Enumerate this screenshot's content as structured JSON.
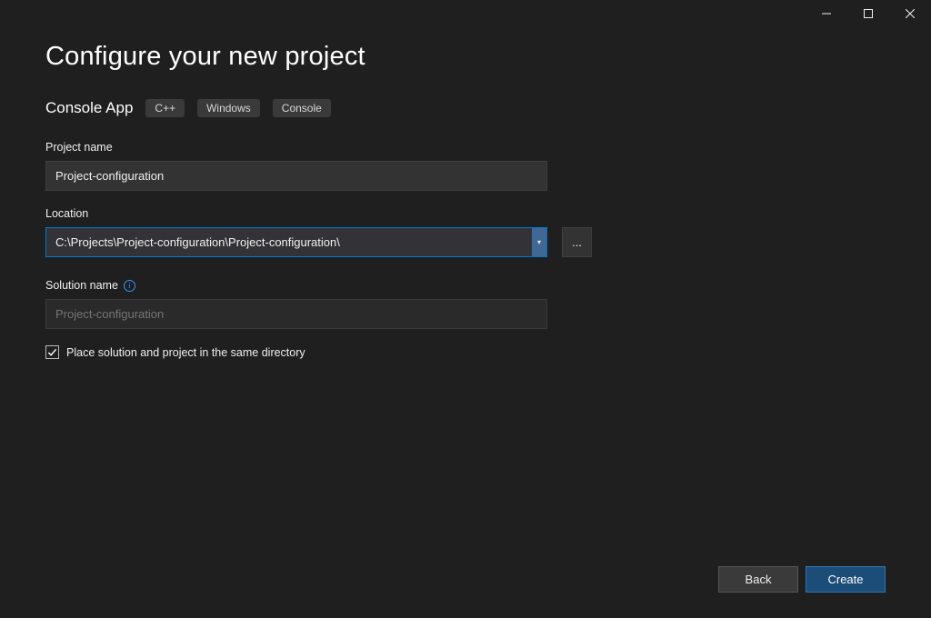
{
  "window": {
    "title": "Configure your new project"
  },
  "template": {
    "name": "Console App",
    "tags": [
      "C++",
      "Windows",
      "Console"
    ]
  },
  "fields": {
    "project_name": {
      "label": "Project name",
      "value": "Project-configuration"
    },
    "location": {
      "label": "Location",
      "value": "C:\\Projects\\Project-configuration\\Project-configuration\\",
      "browse_label": "..."
    },
    "solution_name": {
      "label": "Solution name",
      "placeholder": "Project-configuration",
      "value": ""
    },
    "same_directory": {
      "checked": true,
      "label": "Place solution and project in the same directory"
    }
  },
  "footer": {
    "back": "Back",
    "create": "Create"
  }
}
